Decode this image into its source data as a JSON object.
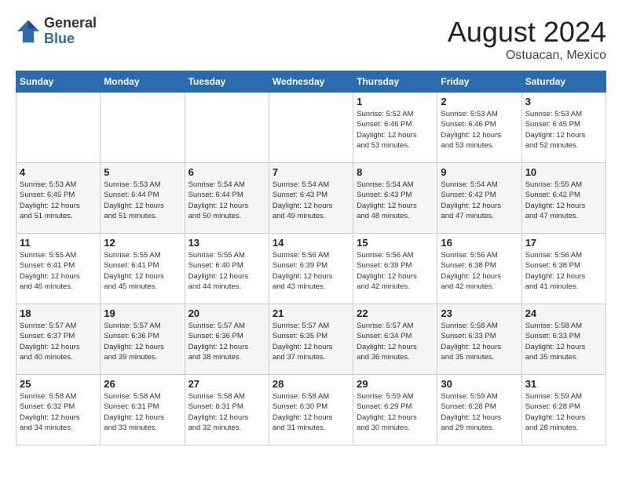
{
  "header": {
    "logo_general": "General",
    "logo_blue": "Blue",
    "month_year": "August 2024",
    "location": "Ostuacan, Mexico"
  },
  "calendar": {
    "days_of_week": [
      "Sunday",
      "Monday",
      "Tuesday",
      "Wednesday",
      "Thursday",
      "Friday",
      "Saturday"
    ],
    "weeks": [
      [
        {
          "day": "",
          "info": ""
        },
        {
          "day": "",
          "info": ""
        },
        {
          "day": "",
          "info": ""
        },
        {
          "day": "",
          "info": ""
        },
        {
          "day": "1",
          "info": "Sunrise: 5:52 AM\nSunset: 6:46 PM\nDaylight: 12 hours\nand 53 minutes."
        },
        {
          "day": "2",
          "info": "Sunrise: 5:53 AM\nSunset: 6:46 PM\nDaylight: 12 hours\nand 53 minutes."
        },
        {
          "day": "3",
          "info": "Sunrise: 5:53 AM\nSunset: 6:45 PM\nDaylight: 12 hours\nand 52 minutes."
        }
      ],
      [
        {
          "day": "4",
          "info": "Sunrise: 5:53 AM\nSunset: 6:45 PM\nDaylight: 12 hours\nand 51 minutes."
        },
        {
          "day": "5",
          "info": "Sunrise: 5:53 AM\nSunset: 6:44 PM\nDaylight: 12 hours\nand 51 minutes."
        },
        {
          "day": "6",
          "info": "Sunrise: 5:54 AM\nSunset: 6:44 PM\nDaylight: 12 hours\nand 50 minutes."
        },
        {
          "day": "7",
          "info": "Sunrise: 5:54 AM\nSunset: 6:43 PM\nDaylight: 12 hours\nand 49 minutes."
        },
        {
          "day": "8",
          "info": "Sunrise: 5:54 AM\nSunset: 6:43 PM\nDaylight: 12 hours\nand 48 minutes."
        },
        {
          "day": "9",
          "info": "Sunrise: 5:54 AM\nSunset: 6:42 PM\nDaylight: 12 hours\nand 47 minutes."
        },
        {
          "day": "10",
          "info": "Sunrise: 5:55 AM\nSunset: 6:42 PM\nDaylight: 12 hours\nand 47 minutes."
        }
      ],
      [
        {
          "day": "11",
          "info": "Sunrise: 5:55 AM\nSunset: 6:41 PM\nDaylight: 12 hours\nand 46 minutes."
        },
        {
          "day": "12",
          "info": "Sunrise: 5:55 AM\nSunset: 6:41 PM\nDaylight: 12 hours\nand 45 minutes."
        },
        {
          "day": "13",
          "info": "Sunrise: 5:55 AM\nSunset: 6:40 PM\nDaylight: 12 hours\nand 44 minutes."
        },
        {
          "day": "14",
          "info": "Sunrise: 5:56 AM\nSunset: 6:39 PM\nDaylight: 12 hours\nand 43 minutes."
        },
        {
          "day": "15",
          "info": "Sunrise: 5:56 AM\nSunset: 6:39 PM\nDaylight: 12 hours\nand 42 minutes."
        },
        {
          "day": "16",
          "info": "Sunrise: 5:56 AM\nSunset: 6:38 PM\nDaylight: 12 hours\nand 42 minutes."
        },
        {
          "day": "17",
          "info": "Sunrise: 5:56 AM\nSunset: 6:38 PM\nDaylight: 12 hours\nand 41 minutes."
        }
      ],
      [
        {
          "day": "18",
          "info": "Sunrise: 5:57 AM\nSunset: 6:37 PM\nDaylight: 12 hours\nand 40 minutes."
        },
        {
          "day": "19",
          "info": "Sunrise: 5:57 AM\nSunset: 6:36 PM\nDaylight: 12 hours\nand 39 minutes."
        },
        {
          "day": "20",
          "info": "Sunrise: 5:57 AM\nSunset: 6:36 PM\nDaylight: 12 hours\nand 38 minutes."
        },
        {
          "day": "21",
          "info": "Sunrise: 5:57 AM\nSunset: 6:35 PM\nDaylight: 12 hours\nand 37 minutes."
        },
        {
          "day": "22",
          "info": "Sunrise: 5:57 AM\nSunset: 6:34 PM\nDaylight: 12 hours\nand 36 minutes."
        },
        {
          "day": "23",
          "info": "Sunrise: 5:58 AM\nSunset: 6:33 PM\nDaylight: 12 hours\nand 35 minutes."
        },
        {
          "day": "24",
          "info": "Sunrise: 5:58 AM\nSunset: 6:33 PM\nDaylight: 12 hours\nand 35 minutes."
        }
      ],
      [
        {
          "day": "25",
          "info": "Sunrise: 5:58 AM\nSunset: 6:32 PM\nDaylight: 12 hours\nand 34 minutes."
        },
        {
          "day": "26",
          "info": "Sunrise: 5:58 AM\nSunset: 6:31 PM\nDaylight: 12 hours\nand 33 minutes."
        },
        {
          "day": "27",
          "info": "Sunrise: 5:58 AM\nSunset: 6:31 PM\nDaylight: 12 hours\nand 32 minutes."
        },
        {
          "day": "28",
          "info": "Sunrise: 5:58 AM\nSunset: 6:30 PM\nDaylight: 12 hours\nand 31 minutes."
        },
        {
          "day": "29",
          "info": "Sunrise: 5:59 AM\nSunset: 6:29 PM\nDaylight: 12 hours\nand 30 minutes."
        },
        {
          "day": "30",
          "info": "Sunrise: 5:59 AM\nSunset: 6:28 PM\nDaylight: 12 hours\nand 29 minutes."
        },
        {
          "day": "31",
          "info": "Sunrise: 5:59 AM\nSunset: 6:28 PM\nDaylight: 12 hours\nand 28 minutes."
        }
      ]
    ]
  }
}
